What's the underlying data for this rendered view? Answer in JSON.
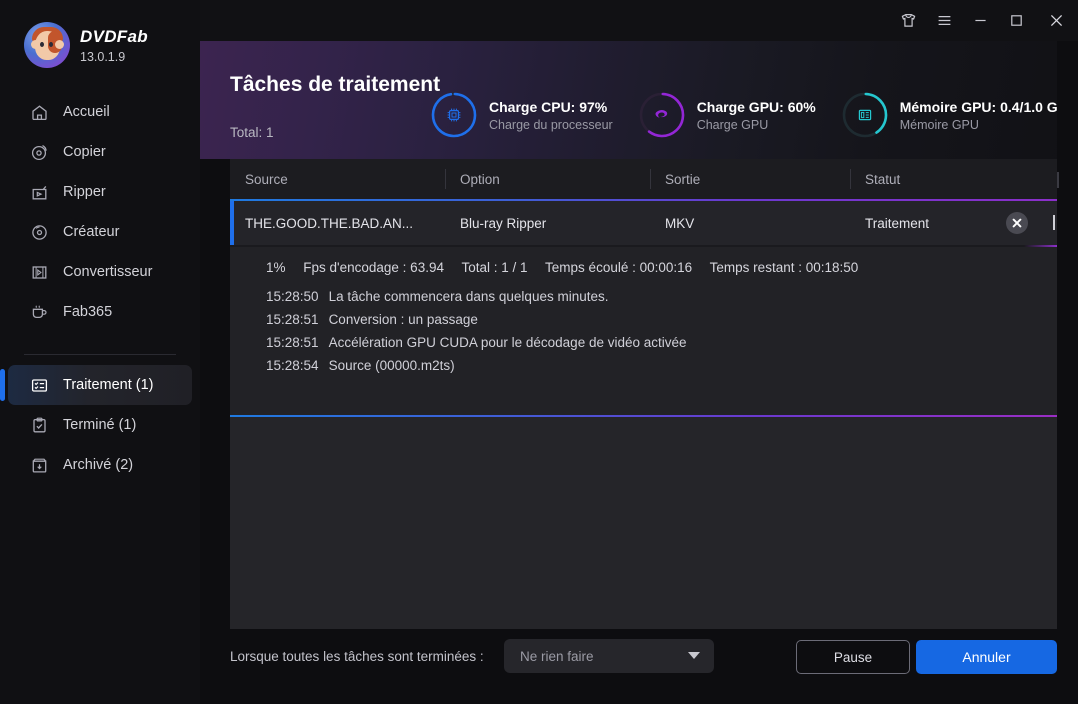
{
  "app": {
    "brand_dvd": "DVD",
    "brand_fab": "Fab",
    "version": "13.0.1.9"
  },
  "titlebar": {
    "skin_icon": "shirt-icon",
    "menu_icon": "hamburger-icon",
    "minimize_icon": "minimize-icon",
    "maximize_icon": "maximize-icon",
    "close_icon": "close-icon"
  },
  "sidebar": {
    "items": [
      {
        "label": "Accueil",
        "icon": "home-icon",
        "active": false
      },
      {
        "label": "Copier",
        "icon": "disc-copy-icon",
        "active": false
      },
      {
        "label": "Ripper",
        "icon": "rip-icon",
        "active": false
      },
      {
        "label": "Créateur",
        "icon": "disc-create-icon",
        "active": false
      },
      {
        "label": "Convertisseur",
        "icon": "film-convert-icon",
        "active": false
      },
      {
        "label": "Fab365",
        "icon": "fab365-icon",
        "active": false
      }
    ],
    "group2": [
      {
        "label": "Traitement (1)",
        "icon": "tasks-icon",
        "active": true
      },
      {
        "label": "Terminé (1)",
        "icon": "clipboard-check-icon",
        "active": false
      },
      {
        "label": "Archivé (2)",
        "icon": "archive-icon",
        "active": false
      }
    ]
  },
  "header": {
    "title": "Tâches de traitement",
    "total_label": "Total:",
    "total_value": "1",
    "gauges": [
      {
        "icon": "cpu-chip-icon",
        "main": "Charge CPU: 97%",
        "sub": "Charge du processeur",
        "percent": 97,
        "color": "#1f6feb",
        "track": "#23242d"
      },
      {
        "icon": "nvidia-logo-icon",
        "main": "Charge GPU: 60%",
        "sub": "Charge GPU",
        "percent": 60,
        "color": "#9326d6",
        "track": "#2a2035"
      },
      {
        "icon": "vram-module-icon",
        "main": "Mémoire GPU: 0.4/1.0 G",
        "sub": "Mémoire GPU",
        "percent": 40,
        "color": "#25c7cf",
        "track": "#1e2b31"
      }
    ]
  },
  "table": {
    "columns": [
      "Source",
      "Option",
      "Sortie",
      "Statut"
    ],
    "rows": [
      {
        "source": "THE.GOOD.THE.BAD.AN...",
        "option": "Blu-ray Ripper",
        "sortie": "MKV",
        "statut": "Traitement",
        "close_icon": "close-circle-icon"
      }
    ]
  },
  "progress": {
    "percent_text": "1%",
    "fps_label": "Fps d'encodage : 63.94",
    "total_label": "Total : 1 / 1",
    "elapsed_label": "Temps écoulé : 00:00:16",
    "remaining_label": "Temps restant : 00:18:50"
  },
  "log": {
    "lines": [
      {
        "time": "15:28:50",
        "text": "La tâche commencera dans quelques minutes."
      },
      {
        "time": "15:28:51",
        "text": "Conversion : un passage"
      },
      {
        "time": "15:28:51",
        "text": "Accélération GPU CUDA pour le décodage de vidéo activée"
      },
      {
        "time": "15:28:54",
        "text": "Source (00000.m2ts)"
      }
    ]
  },
  "footer": {
    "when_done_label": "Lorsque toutes les tâches sont terminées :",
    "dropdown_value": "Ne rien faire",
    "dropdown_icon": "chevron-down-icon",
    "pause_label": "Pause",
    "cancel_label": "Annuler"
  },
  "colors": {
    "accent_blue": "#1f6feb",
    "accent_purple": "#9326d6",
    "accent_cyan": "#25c7cf",
    "panel_bg": "#222226",
    "sidebar_bg": "#101013"
  }
}
